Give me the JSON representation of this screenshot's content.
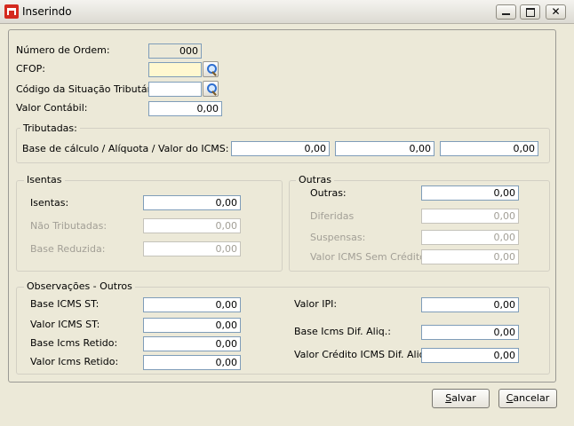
{
  "window": {
    "title": "Inserindo",
    "close_glyph": "✕"
  },
  "top": {
    "numero_ordem_label": "Número de Ordem:",
    "numero_ordem_value": "000",
    "cfop_label": "CFOP:",
    "cfop_value": "",
    "cst_label": "Código da Situação Tributária:",
    "cst_value": "",
    "valor_contabil_label": "Valor Contábil:",
    "valor_contabil_value": "0,00"
  },
  "tributadas": {
    "title": "Tributadas:",
    "label": "Base de cálculo / Alíquota / Valor do ICMS:",
    "base": "0,00",
    "aliquota": "0,00",
    "valor": "0,00"
  },
  "isentas": {
    "title": "Isentas",
    "isentas_label": "Isentas:",
    "isentas_value": "0,00",
    "nao_tributadas_label": "Não Tributadas:",
    "nao_tributadas_value": "0,00",
    "base_reduzida_label": "Base Reduzida:",
    "base_reduzida_value": "0,00"
  },
  "outras": {
    "title": "Outras",
    "outras_label": "Outras:",
    "outras_value": "0,00",
    "diferidas_label": "Diferidas",
    "diferidas_value": "0,00",
    "suspensas_label": "Suspensas:",
    "suspensas_value": "0,00",
    "icms_sem_credito_label": "Valor ICMS Sem Crédito:",
    "icms_sem_credito_value": "0,00"
  },
  "observacoes": {
    "title": "Observações - Outros",
    "base_icms_st_label": "Base ICMS ST:",
    "base_icms_st_value": "0,00",
    "valor_icms_st_label": "Valor ICMS ST:",
    "valor_icms_st_value": "0,00",
    "base_icms_retido_label": "Base Icms Retido:",
    "base_icms_retido_value": "0,00",
    "valor_icms_retido_label": "Valor Icms Retido:",
    "valor_icms_retido_value": "0,00",
    "valor_ipi_label": "Valor IPI:",
    "valor_ipi_value": "0,00",
    "base_icms_dif_label": "Base Icms Dif. Aliq.:",
    "base_icms_dif_value": "0,00",
    "valor_credito_dif_label": "Valor Crédito ICMS Dif. Aliq.:",
    "valor_credito_dif_value": "0,00"
  },
  "buttons": {
    "salvar_mnemonic": "S",
    "salvar_rest": "alvar",
    "cancelar_mnemonic": "C",
    "cancelar_rest": "ancelar"
  },
  "colors": {
    "accent_field": "#fff8d0",
    "field_border": "#7f9db9",
    "disabled_text": "#a29f96"
  }
}
